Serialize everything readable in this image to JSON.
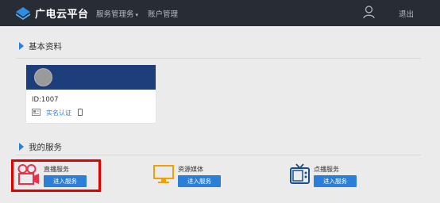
{
  "app": {
    "brand": "广电云平台"
  },
  "nav": {
    "services_label": "服务管理务",
    "services_caret": "▾",
    "account_label": "账户管理",
    "logout_label": "退出"
  },
  "basic": {
    "title": "基本资料",
    "id_text": "ID:1007",
    "verify_label": "实名认证"
  },
  "services": {
    "title": "我的服务",
    "items": [
      {
        "name": "直播服务",
        "button": "进入服务"
      },
      {
        "name": "资源媒体",
        "button": "进入服务"
      },
      {
        "name": "点播服务",
        "button": "进入服务"
      }
    ]
  },
  "colors": {
    "topbar": "#282c34",
    "accent": "#2b7fd6",
    "card_header": "#1d3e7a",
    "highlight": "#e00000",
    "live_icon": "#e8314b",
    "media_icon": "#f0a000",
    "vod_icon": "#1a4f8b"
  }
}
